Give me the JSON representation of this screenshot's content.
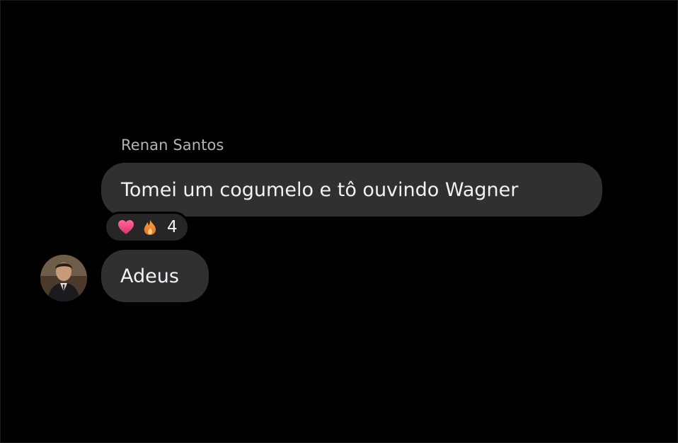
{
  "messages": [
    {
      "sender": "Renan Santos",
      "text": "Tomei um cogumelo e tô ouvindo Wagner",
      "reactions": {
        "icons": [
          "heart-icon",
          "fire-icon"
        ],
        "count": "4"
      }
    },
    {
      "text": "Adeus"
    }
  ],
  "colors": {
    "background": "#000000",
    "bubble": "#303030",
    "sender_name": "#b0b3b8",
    "message_text": "#f0f2f5",
    "heart": "#f0457a",
    "fire": "#f28a2e"
  }
}
